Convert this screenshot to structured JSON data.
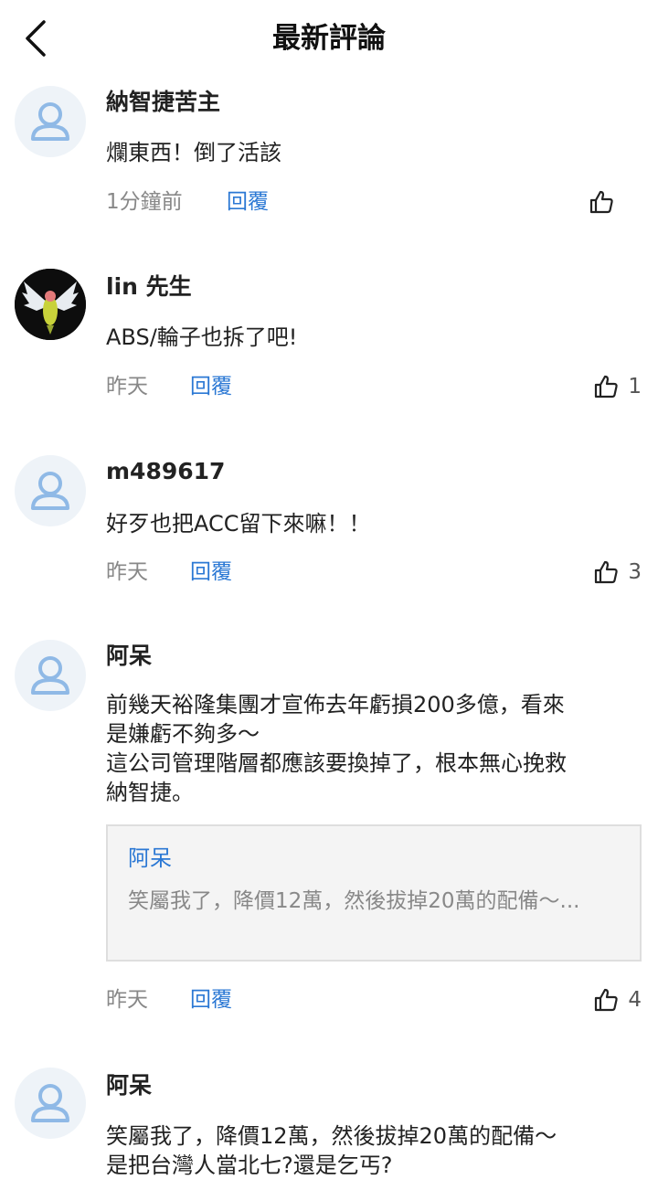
{
  "header": {
    "title": "最新評論"
  },
  "comments": [
    {
      "name": "納智捷苦主",
      "lines": [
        "爛東西！倒了活該"
      ],
      "time": "1分鐘前",
      "reply": "回覆",
      "likes": ""
    },
    {
      "name": "lin 先生",
      "lines": [
        "ABS/輪子也拆了吧!"
      ],
      "time": "昨天",
      "reply": "回覆",
      "likes": "1"
    },
    {
      "name": "m489617",
      "lines": [
        "好歹也把ACC留下來嘛！！"
      ],
      "time": "昨天",
      "reply": "回覆",
      "likes": "3"
    },
    {
      "name": "阿呆",
      "lines": [
        "前幾天裕隆集團才宣佈去年虧損200多億，看來",
        "是嫌虧不夠多～",
        "這公司管理階層都應該要換掉了，根本無心挽救",
        "納智捷。"
      ],
      "quote": {
        "name": "阿呆",
        "text": "笑屬我了，降價12萬，然後拔掉20萬的配備～..."
      },
      "time": "昨天",
      "reply": "回覆",
      "likes": "4"
    },
    {
      "name": "阿呆",
      "lines": [
        "笑屬我了，降價12萬，然後拔掉20萬的配備～",
        "是把台灣人當北七?還是乞丐?"
      ],
      "time": "",
      "reply": "",
      "likes": ""
    }
  ],
  "icons": {
    "back": "chevron-left-icon",
    "like": "thumbs-up-icon",
    "avatar": "user-icon"
  },
  "colors": {
    "link": "#2b78d4",
    "avatar_bg": "#eef3f8",
    "avatar_icon": "#8fb9e6"
  }
}
